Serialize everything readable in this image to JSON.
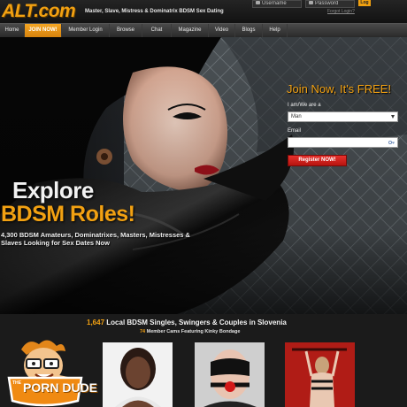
{
  "header": {
    "logo": "ALT.com",
    "tagline": "Master, Slave, Mistress & Dominatrix BDSM Sex Dating",
    "username_placeholder": "Username",
    "password_placeholder": "Password",
    "login_label": "Log",
    "forgot_label": "Forgot Login?"
  },
  "nav": {
    "items": [
      {
        "label": "Home",
        "active": false
      },
      {
        "label": "JOIN NOW!",
        "active": true
      },
      {
        "label": "Member Login",
        "active": false
      },
      {
        "label": "Browse",
        "active": false
      },
      {
        "label": "Chat",
        "active": false
      },
      {
        "label": "Magazine",
        "active": false
      },
      {
        "label": "Video",
        "active": false
      },
      {
        "label": "Blogs",
        "active": false
      },
      {
        "label": "Help",
        "active": false
      }
    ]
  },
  "hero": {
    "explore": "Explore",
    "roles": "BDSM Roles!",
    "sub_line_1": "4,300 BDSM Amateurs, Dominatrixes, Masters, Mistresses &",
    "sub_line_2": "Slaves Looking for Sex Dates Now"
  },
  "join_form": {
    "title": "Join Now, It's FREE!",
    "iam_label": "I am/We are a",
    "iam_value": "Man",
    "email_label": "Email",
    "register_label": "Register NOW!"
  },
  "listing": {
    "singles_count": "1,647",
    "singles_text": "Local BDSM Singles, Swingers & Couples in Slovenia",
    "cams_count": "74",
    "cams_text": "Member Cams Featuring Kinky Bondage"
  },
  "badge": {
    "the": "THE",
    "name": "PORN DUDE"
  },
  "colors": {
    "accent": "#f2a112",
    "register": "#d0201c",
    "background": "#1b1b1b"
  }
}
